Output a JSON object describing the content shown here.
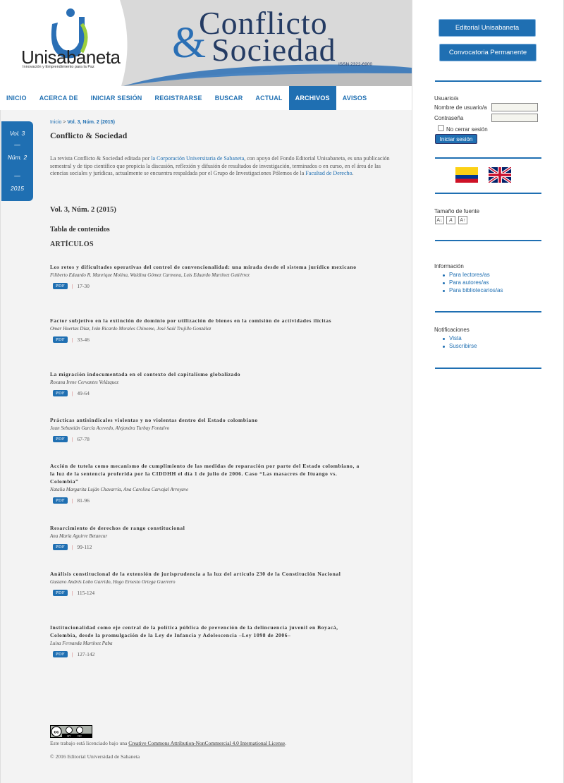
{
  "header": {
    "logo_word": "Unisabaneta",
    "logo_tagline": "Innovación y Emprendimiento para la Paz",
    "title_line1": "Conflicto",
    "title_amp": "&",
    "title_line2": "Sociedad",
    "issn": "ISSN 2322-6900"
  },
  "nav": {
    "items": [
      {
        "label": "INICIO"
      },
      {
        "label": "ACERCA DE"
      },
      {
        "label": "INICIAR SESIÓN"
      },
      {
        "label": "REGISTRARSE"
      },
      {
        "label": "BUSCAR"
      },
      {
        "label": "ACTUAL"
      },
      {
        "label": "ARCHIVOS",
        "active": true
      },
      {
        "label": "AVISOS"
      }
    ]
  },
  "issue_badge": {
    "vol": "Vol. 3",
    "dash1": "—",
    "num": "Núm. 2",
    "dash2": "—",
    "year": "2015"
  },
  "breadcrumb": {
    "home": "Inicio",
    "separator": ">",
    "current": "Vol. 3, Núm. 2 (2015)"
  },
  "page_title": "Conflicto & Sociedad",
  "description": {
    "part1": "La revista Conflicto & Sociedad editada por ",
    "part2": "la Corporación Universitaria de Sabaneta",
    "part3": ", con apoyo del Fondo Editorial Unisabaneta, es una publicación semestral y de tipo científico que propicia la discusión, reflexión y difusión de resultados de investigación, terminados o en curso, en el área de las ciencias sociales y jurídicas, actualmente se encuentra respaldada por el Grupo de Investigaciones Pólemos de la ",
    "part4": "Facultad de Derecho",
    "part5": "."
  },
  "issue_heading": "Vol. 3, Núm. 2 (2015)",
  "toc_heading": "Tabla de contenidos",
  "section_heading": "ARTÍCULOS",
  "articles": [
    {
      "title": "Los retos y dificultades operativas del control de convencionalidad: una mirada desde el sistema jurídico mexicano",
      "authors": "Filiberto Eduardo R. Manrique Molina, Waldina Gómez Carmona, Luis Eduardo Martínez Gutiérrez",
      "galley": "PDF",
      "sep": "|",
      "pages": "17-30"
    },
    {
      "title": "Factor subjetivo en la extinción de dominio por utilización de bienes en la comisión de actividades ilícitas",
      "authors": "Omar Huertas Díaz, Iván Ricardo Morales Chinome, José Saúl Trujillo González",
      "galley": "PDF",
      "sep": "|",
      "pages": "33-46"
    },
    {
      "title": "La migración indocumentada en el contexto del capitalismo globalizado",
      "authors": "Roxana Irene Cervantes Velázquez",
      "galley": "PDF",
      "sep": "|",
      "pages": "49-64"
    },
    {
      "title": "Prácticas antisindicales violentas y no violentas dentro del Estado colombiano",
      "authors": "Juan Sebastián García Acevedo, Alejandra Turbay Fontalvo",
      "galley": "PDF",
      "sep": "|",
      "pages": "67-78"
    },
    {
      "title": "Acción de tutela como mecanismo de cumplimiento de las medidas de reparación por parte del Estado colombiano, a la luz de la sentencia proferida por la CIDDHH el día 1 de julio de 2006. Caso “Las masacres de Ituango vs. Colombia”",
      "authors": "Natalia Margarita Luján Chavarría, Ana Carolina Carvajal Arroyave",
      "galley": "PDF",
      "sep": "|",
      "pages": "81-96"
    },
    {
      "title": "Resarcimiento de derechos de rango constitucional",
      "authors": "Ana María Aguirre Betancur",
      "galley": "PDF",
      "sep": "|",
      "pages": "99-112"
    },
    {
      "title": "Análisis constitucional de la extensión de jurisprudencia a la luz del artículo 230 de la Constitución Nacional",
      "authors": "Gustavo Andrés Lobo Garrido, Hugo Ernesto Ortega Guerrero",
      "galley": "PDF",
      "sep": "|",
      "pages": "115-124"
    },
    {
      "title": "Institucionalidad como eje central de la política pública de prevención de la delincuencia juvenil en Boyacá, Colombia, desde la promulgación de la Ley de Infancia y Adolescencia –Ley 1098 de 2006–",
      "authors": "Luisa Fernanda Martínez Paba",
      "galley": "PDF",
      "sep": "|",
      "pages": "127-142"
    }
  ],
  "footer": {
    "license_prefix": "Este trabajo está licenciado bajo una ",
    "license_link": "Creative Commons Attribution-NonCommercial 4.0 International License",
    "license_suffix": ".",
    "copyright": "© 2016 Editorial Universidad de Sabaneta",
    "cc_label": "cc",
    "cc_by": "BY",
    "cc_nc": "NC"
  },
  "sidebar": {
    "btn_editorial": "Editorial Unisabaneta",
    "btn_convocatoria": "Convocatoria Permanente",
    "user_block_title": "Usuario/a",
    "username_label": "Nombre de usuario/a",
    "password_label": "Contraseña",
    "remember_label": "No cerrar sesión",
    "login_button": "Iniciar sesión",
    "font_size_title": "Tamaño de fuente",
    "font_buttons": [
      "A↓",
      "A",
      "A↑"
    ],
    "info_title": "Información",
    "info_links": [
      "Para lectores/as",
      "Para autores/as",
      "Para bibliotecarios/as"
    ],
    "notif_title": "Notificaciones",
    "notif_links": [
      "Vista",
      "Suscribirse"
    ]
  },
  "colors": {
    "brand_blue": "#1f6fb2",
    "navy": "#243b63",
    "sidebar_rule": "#1f6fb2"
  }
}
